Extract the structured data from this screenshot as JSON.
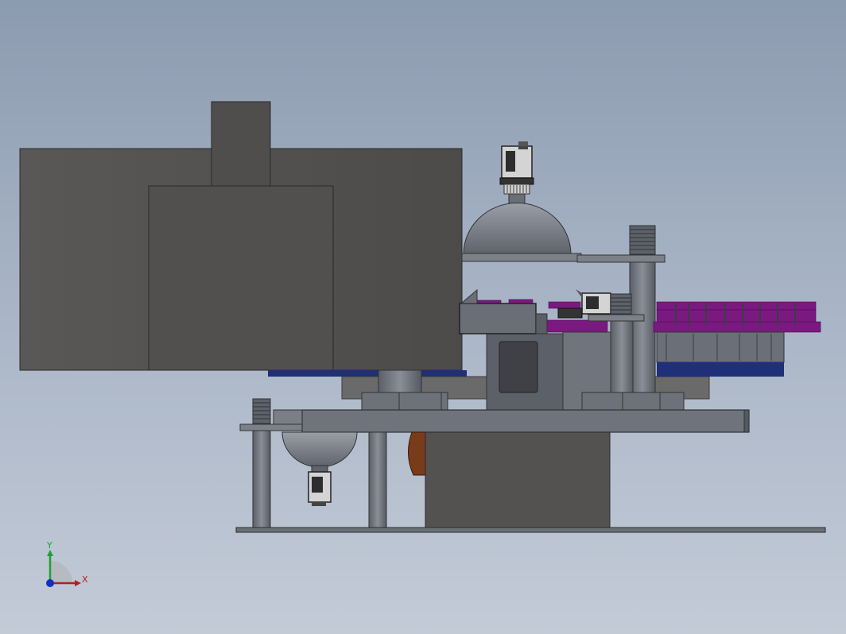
{
  "viewport": {
    "background_top": "#8c9bb0",
    "background_bottom": "#c3cbd7"
  },
  "colors": {
    "housing": "#545250",
    "housing_dark": "#4a4948",
    "steel": "#6d7179",
    "steel_light": "#8b8f98",
    "steel_dark": "#3f434a",
    "dome": "#7f838c",
    "belt_blue": "#1f2f78",
    "purple_part": "#7a1a80",
    "wood": "#7a3b1a"
  },
  "triad": {
    "x_label": "X",
    "y_label": "Y",
    "x_color": "#b42020",
    "y_color": "#20a030",
    "z_color": "#1030c0"
  }
}
